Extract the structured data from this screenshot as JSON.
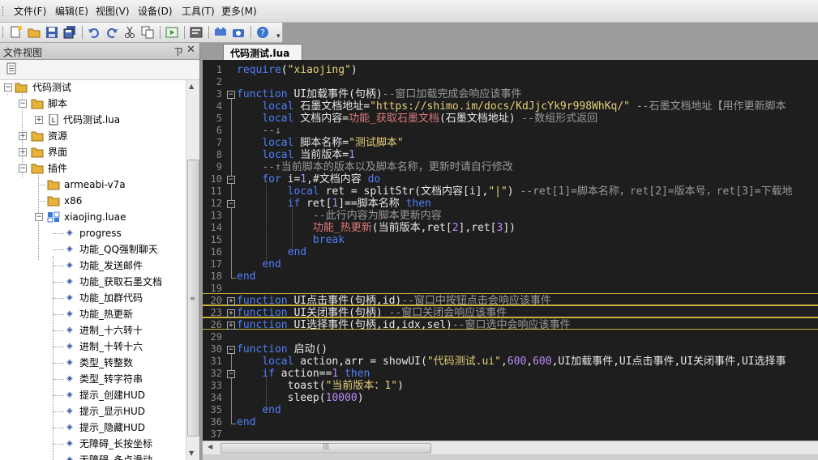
{
  "menu": {
    "items": [
      "文件(F)",
      "编辑(E)",
      "视图(V)",
      "设备(D)",
      "工具(T)",
      "更多(M)"
    ]
  },
  "toolbar": {
    "icons": [
      "new-file-icon",
      "open-folder-icon",
      "save-icon",
      "save-all-icon",
      "undo-icon",
      "redo-icon",
      "cut-icon",
      "copy-icon",
      "run-icon",
      "console-icon",
      "device-icon",
      "screenshot-icon",
      "help-icon"
    ]
  },
  "panel": {
    "title": "文件视图",
    "pin": "ㄗ",
    "close": "✕"
  },
  "tree": {
    "root": "代码测试",
    "folder_script": "脚本",
    "file_lua": "代码测试.lua",
    "folder_res": "资源",
    "folder_ui": "界面",
    "folder_plugin": "插件",
    "sub_arm": "armeabi-v7a",
    "sub_x86": "x86",
    "luae": "xiaojing.luae",
    "functions": [
      "progress",
      "功能_QQ强制聊天",
      "功能_发送邮件",
      "功能_获取石墨文档",
      "功能_加群代码",
      "功能_热更新",
      "进制_十六转十",
      "进制_十转十六",
      "类型_转整数",
      "类型_转字符串",
      "提示_创建HUD",
      "提示_显示HUD",
      "提示_隐藏HUD",
      "无障碍_长按坐标",
      "无障碍_多点滑动"
    ]
  },
  "tab": {
    "label": "代码测试.lua"
  },
  "editor": {
    "lines": [
      {
        "n": "1",
        "html": "<span class=\"k\">require</span>(<span class=\"s\">\"xiaojing\"</span>)"
      },
      {
        "n": "2",
        "html": ""
      },
      {
        "n": "3",
        "html": "<span class=\"k\">function</span> UI加载事件(句柄)<span class=\"c\">--窗口加载完成会响应该事件</span>"
      },
      {
        "n": "4",
        "html": "    <span class=\"k\">local</span> 石墨文档地址=<span class=\"s\">\"https://shimo.im/docs/KdJjcYk9r998WhKq/\"</span> <span class=\"c\">--石墨文档地址【用作更新脚本</span>"
      },
      {
        "n": "5",
        "html": "    <span class=\"k\">local</span> 文档内容=<span class=\"f\">功能_获取石墨文档</span>(石墨文档地址) <span class=\"c\">--数组形式返回</span>"
      },
      {
        "n": "6",
        "html": "    <span class=\"c\">--↓</span>"
      },
      {
        "n": "7",
        "html": "    <span class=\"k\">local</span> 脚本名称=<span class=\"s\">\"测试脚本\"</span>"
      },
      {
        "n": "8",
        "html": "    <span class=\"k\">local</span> 当前版本=<span class=\"n\">1</span>"
      },
      {
        "n": "9",
        "html": "    <span class=\"c\">--↑当前脚本的版本以及脚本名称，更新时请自行修改</span>"
      },
      {
        "n": "10",
        "html": "    <span class=\"k\">for</span> i=<span class=\"n\">1</span>,#文档内容 <span class=\"k\">do</span>"
      },
      {
        "n": "11",
        "html": "        <span class=\"k\">local</span> ret = splitStr(文档内容[i],<span class=\"s\">\"|\"</span>) <span class=\"c\">--ret[1]=脚本名称，ret[2]=版本号，ret[3]=下载地</span>"
      },
      {
        "n": "12",
        "html": "        <span class=\"k\">if</span> ret[<span class=\"n\">1</span>]==脚本名称 <span class=\"k\">then</span>"
      },
      {
        "n": "13",
        "html": "            <span class=\"c\">--此行内容为脚本更新内容</span>"
      },
      {
        "n": "14",
        "html": "            <span class=\"f\">功能_热更新</span>(当前版本,ret[<span class=\"n\">2</span>],ret[<span class=\"n\">3</span>])"
      },
      {
        "n": "15",
        "html": "            <span class=\"k\">break</span>"
      },
      {
        "n": "16",
        "html": "        <span class=\"k\">end</span>"
      },
      {
        "n": "17",
        "html": "    <span class=\"k\">end</span>"
      },
      {
        "n": "18",
        "html": "<span class=\"k\">end</span>"
      },
      {
        "n": "19",
        "html": ""
      },
      {
        "n": "20",
        "html": "<span class=\"k\">function</span> UI点击事件(句柄,id)<span class=\"c\">--窗口中按钮点击会响应该事件</span>"
      },
      {
        "n": "23",
        "html": "<span class=\"k\">function</span> UI关闭事件(句柄) <span class=\"c\">--窗口关闭会响应该事件</span>"
      },
      {
        "n": "26",
        "html": "<span class=\"k\">function</span> UI选择事件(句柄,id,idx,sel)<span class=\"c\">--窗口选中会响应该事件</span>"
      },
      {
        "n": "29",
        "html": ""
      },
      {
        "n": "30",
        "html": "<span class=\"k\">function</span> 启动()"
      },
      {
        "n": "31",
        "html": "    <span class=\"k\">local</span> action,arr = showUI(<span class=\"s\">\"代码测试.ui\"</span>,<span class=\"n\">600</span>,<span class=\"n\">600</span>,UI加载事件,UI点击事件,UI关闭事件,UI选择事"
      },
      {
        "n": "32",
        "html": "    <span class=\"k\">if</span> action==<span class=\"n\">1</span> <span class=\"k\">then</span>"
      },
      {
        "n": "33",
        "html": "        toast(<span class=\"s\">\"当前版本：1\"</span>)"
      },
      {
        "n": "34",
        "html": "        sleep(<span class=\"n\">10000</span>)"
      },
      {
        "n": "35",
        "html": "    <span class=\"k\">end</span>"
      },
      {
        "n": "36",
        "html": "<span class=\"k\">end</span>"
      },
      {
        "n": "37",
        "html": ""
      }
    ]
  },
  "colors": {
    "keyword": "#4f7ff8",
    "string": "#e6d07a",
    "number": "#b98cf8",
    "comment": "#9a9a9a",
    "function_call": "#e07a7a",
    "editor_bg": "#1e1e1e",
    "highlight_border": "#c8b23a"
  }
}
